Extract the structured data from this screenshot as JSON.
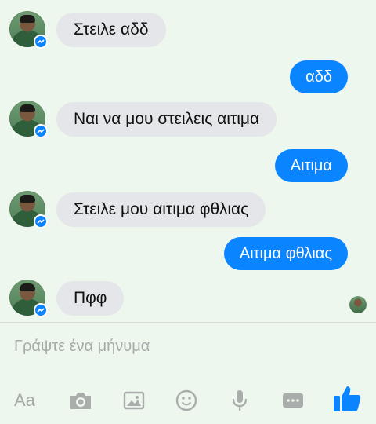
{
  "messages": [
    {
      "side": "in",
      "text": "Στειλε αδδ"
    },
    {
      "side": "out",
      "text": "αδδ"
    },
    {
      "side": "in",
      "text": "Ναι να μου στειλεις αιτιμα"
    },
    {
      "side": "out",
      "text": "Αιτιμα"
    },
    {
      "side": "in",
      "text": "Στειλε μου αιτιμα φθλιας"
    },
    {
      "side": "out",
      "text": "Αιτιμα φθλιας"
    },
    {
      "side": "in",
      "text": "Πφφ"
    }
  ],
  "composer": {
    "placeholder": "Γράψτε ένα μήνυμα"
  },
  "toolbar": {
    "text_format_label": "Aa",
    "icons": [
      "camera-icon",
      "gallery-icon",
      "emoji-icon",
      "microphone-icon",
      "more-icon",
      "like-icon"
    ]
  },
  "colors": {
    "background": "#eef7ee",
    "incoming_bubble": "#e4e6e9",
    "outgoing_bubble": "#0a84ff",
    "accent": "#0a84ff"
  }
}
